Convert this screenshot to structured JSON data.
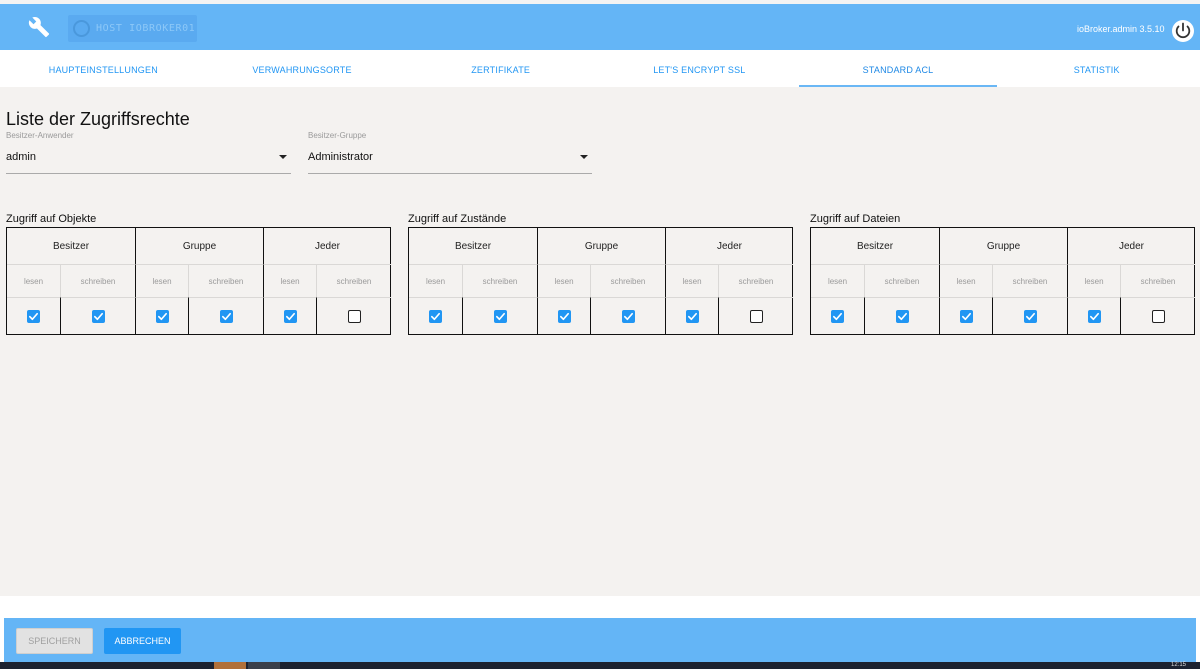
{
  "header": {
    "host_label": "HOST IOBROKER01",
    "version": "ioBroker.admin 3.5.10",
    "icons": [
      "wrench-icon",
      "power-icon"
    ]
  },
  "tabs": [
    {
      "label": "HAUPTEINSTELLUNGEN"
    },
    {
      "label": "VERWAHRUNGSORTE"
    },
    {
      "label": "ZERTIFIKATE"
    },
    {
      "label": "LET'S ENCRYPT SSL"
    },
    {
      "label": "STANDARD ACL",
      "active": true
    },
    {
      "label": "STATISTIK"
    }
  ],
  "main": {
    "title": "Liste der Zugriffsrechte",
    "owner_user": {
      "label": "Besitzer-Anwender",
      "value": "admin"
    },
    "owner_group": {
      "label": "Besitzer-Gruppe",
      "value": "Administrator"
    },
    "sections": [
      {
        "title": "Zugriff auf Objekte",
        "groups": [
          {
            "label": "Besitzer",
            "perms": [
              {
                "label": "lesen",
                "checked": true
              },
              {
                "label": "schreiben",
                "checked": true
              }
            ]
          },
          {
            "label": "Gruppe",
            "perms": [
              {
                "label": "lesen",
                "checked": true
              },
              {
                "label": "schreiben",
                "checked": true
              }
            ]
          },
          {
            "label": "Jeder",
            "perms": [
              {
                "label": "lesen",
                "checked": true
              },
              {
                "label": "schreiben",
                "checked": false
              }
            ]
          }
        ]
      },
      {
        "title": "Zugriff auf Zustände",
        "groups": [
          {
            "label": "Besitzer",
            "perms": [
              {
                "label": "lesen",
                "checked": true
              },
              {
                "label": "schreiben",
                "checked": true
              }
            ]
          },
          {
            "label": "Gruppe",
            "perms": [
              {
                "label": "lesen",
                "checked": true
              },
              {
                "label": "schreiben",
                "checked": true
              }
            ]
          },
          {
            "label": "Jeder",
            "perms": [
              {
                "label": "lesen",
                "checked": true
              },
              {
                "label": "schreiben",
                "checked": false
              }
            ]
          }
        ]
      },
      {
        "title": "Zugriff auf Dateien",
        "groups": [
          {
            "label": "Besitzer",
            "perms": [
              {
                "label": "lesen",
                "checked": true
              },
              {
                "label": "schreiben",
                "checked": true
              }
            ]
          },
          {
            "label": "Gruppe",
            "perms": [
              {
                "label": "lesen",
                "checked": true
              },
              {
                "label": "schreiben",
                "checked": true
              }
            ]
          },
          {
            "label": "Jeder",
            "perms": [
              {
                "label": "lesen",
                "checked": true
              },
              {
                "label": "schreiben",
                "checked": false
              }
            ]
          }
        ]
      }
    ]
  },
  "footer": {
    "save_label": "SPEICHERN",
    "cancel_label": "ABBRECHEN"
  },
  "taskbar": {
    "time": "12:15"
  },
  "colors": {
    "header_bg": "#64b5f6",
    "accent": "#2196f3",
    "content_bg": "#f4f2f0"
  }
}
